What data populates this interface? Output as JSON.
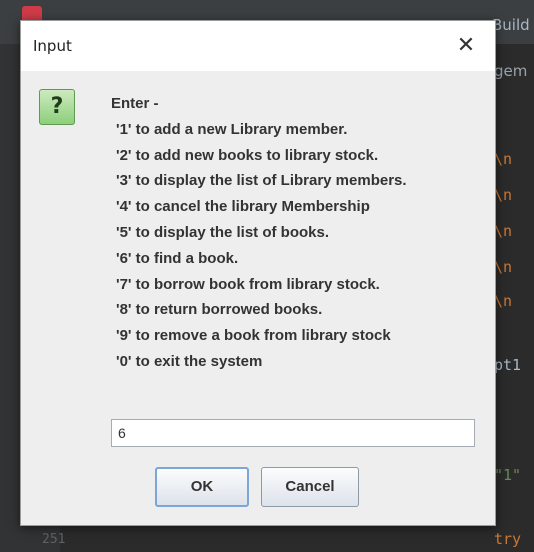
{
  "ide": {
    "menu_build": "Build",
    "tab_fragment": "gem",
    "code_fragments": [
      "\\n",
      "\\n",
      "\\n",
      "\\n",
      "\\n"
    ],
    "code_opt": "pt1",
    "code_one": "\"1\"",
    "code_try": "try",
    "line_number": "251"
  },
  "dialog": {
    "title": "Input",
    "close_glyph": "✕",
    "icon_glyph": "?",
    "message": {
      "header": "Enter -",
      "options": [
        "'1' to add a new Library member.",
        "'2' to add new books to library stock.",
        "'3' to display the list of Library members.",
        "'4' to cancel the library Membership",
        "'5' to display the list of books.",
        "'6' to find a book.",
        "'7' to borrow book from library stock.",
        "'8' to return borrowed books.",
        "'9' to remove a book from library stock",
        "'0' to exit the system"
      ]
    },
    "input_value": "6",
    "ok_label": "OK",
    "cancel_label": "Cancel"
  },
  "colors": {
    "ide_background": "#2b2b2b",
    "dialog_background": "#eeeeee",
    "icon_green": "#8ccf7a",
    "ok_focus_border": "#7ba6d6"
  }
}
